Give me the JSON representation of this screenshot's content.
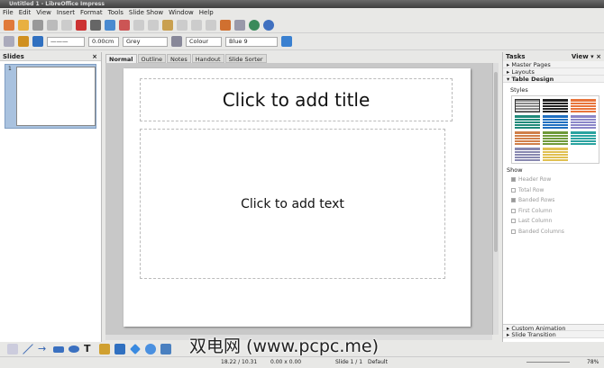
{
  "window": {
    "title": "Untitled 1 - LibreOffice Impress"
  },
  "menu": [
    "File",
    "Edit",
    "View",
    "Insert",
    "Format",
    "Tools",
    "Slide Show",
    "Window",
    "Help"
  ],
  "toolbar2": {
    "line_width": "0.00cm",
    "line_color": "Grey",
    "area_style": "Colour",
    "area_color": "Blue 9"
  },
  "slides_panel": {
    "title": "Slides",
    "close": "×",
    "slide_number": "1"
  },
  "view_tabs": [
    "Normal",
    "Outline",
    "Notes",
    "Handout",
    "Slide Sorter"
  ],
  "slide": {
    "title_placeholder": "Click to add title",
    "text_placeholder": "Click to add text"
  },
  "tasks": {
    "title": "Tasks",
    "view": "View",
    "close": "×",
    "sections": [
      "Master Pages",
      "Layouts",
      "Table Design"
    ],
    "styles_label": "Styles",
    "show_label": "Show",
    "options": [
      {
        "label": "Header Row",
        "checked": true
      },
      {
        "label": "Total Row",
        "checked": false
      },
      {
        "label": "Banded Rows",
        "checked": true
      },
      {
        "label": "First Column",
        "checked": false
      },
      {
        "label": "Last Column",
        "checked": false
      },
      {
        "label": "Banded Columns",
        "checked": false
      }
    ],
    "bottom_sections": [
      "Custom Animation",
      "Slide Transition"
    ],
    "style_colors": [
      "#888888",
      "#222222",
      "#e8743b",
      "#1f8a7a",
      "#1f6fc0",
      "#8a86c8",
      "#d0804a",
      "#6f9a3a",
      "#2aa3a0",
      "#8888b0",
      "#e0c050"
    ]
  },
  "status": {
    "position": "18.22 / 10.31",
    "size": "0.00 x 0.00",
    "slide": "Slide 1 / 1",
    "layout": "Default",
    "zoom": "78%"
  },
  "watermark": "双电网 (www.pcpc.me)"
}
